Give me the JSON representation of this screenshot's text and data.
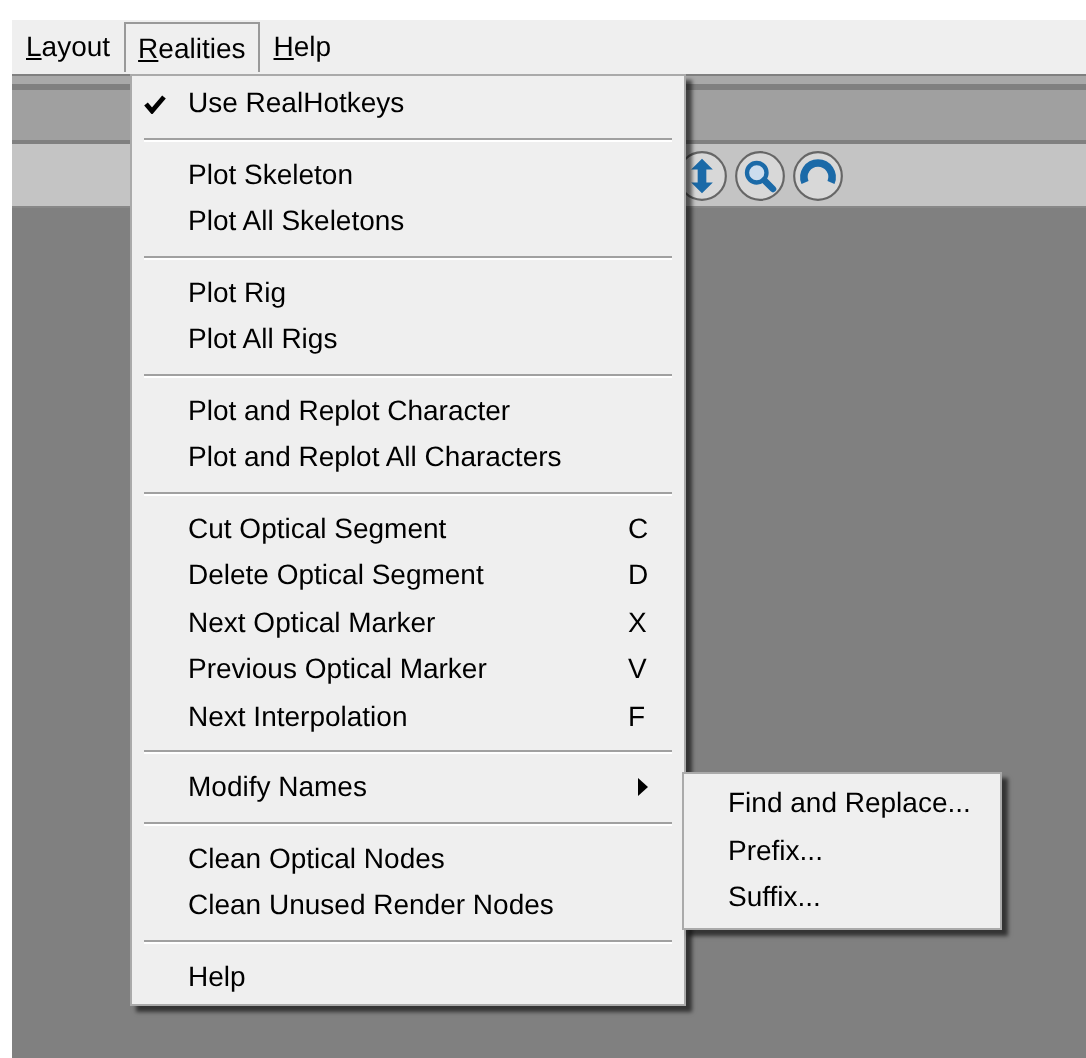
{
  "menubar": [
    {
      "label": "Layout",
      "selected": false
    },
    {
      "label": "Realities",
      "selected": true
    },
    {
      "label": "Help",
      "selected": false
    }
  ],
  "menu": {
    "groups": [
      [
        {
          "label": "Use RealHotkeys",
          "checked": true
        }
      ],
      [
        {
          "label": "Plot Skeleton",
          "checked": false
        },
        {
          "label": "Plot All Skeletons",
          "checked": false
        }
      ],
      [
        {
          "label": "Plot Rig",
          "checked": false
        },
        {
          "label": "Plot All Rigs",
          "checked": false
        }
      ],
      [
        {
          "label": "Plot and Replot Character",
          "checked": false
        },
        {
          "label": "Plot and Replot All Characters",
          "checked": false
        }
      ],
      [
        {
          "label": "Cut Optical Segment",
          "shortcut": "C",
          "checked": false
        },
        {
          "label": "Delete Optical Segment",
          "shortcut": "D",
          "checked": false
        },
        {
          "label": "Next Optical Marker",
          "shortcut": "X",
          "checked": false
        },
        {
          "label": "Previous Optical Marker",
          "shortcut": "V",
          "checked": false
        },
        {
          "label": "Next Interpolation",
          "shortcut": "F",
          "checked": false
        }
      ],
      [
        {
          "label": "Modify Names",
          "checked": false,
          "expanded": true,
          "submenu": [
            "Find and Replace...",
            "Prefix...",
            "Suffix..."
          ]
        }
      ],
      [
        {
          "label": "Clean Optical Nodes",
          "checked": false
        },
        {
          "label": "Clean Unused Render Nodes",
          "checked": false
        }
      ],
      [
        {
          "label": "Help",
          "checked": false
        }
      ]
    ]
  }
}
